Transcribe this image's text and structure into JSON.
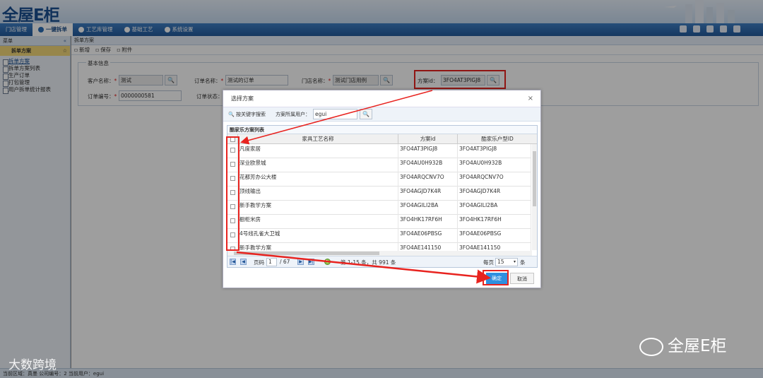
{
  "app": {
    "logo": "全屋E柜"
  },
  "nav": {
    "tabs": [
      {
        "label": "门店管理"
      },
      {
        "label": "一键拆单"
      },
      {
        "label": "工艺库管理"
      },
      {
        "label": "基础工艺"
      },
      {
        "label": "系统设置"
      }
    ]
  },
  "sidebar": {
    "title": "菜单",
    "collapse": "«",
    "group": "拆单方案",
    "group_toggle": "☆",
    "items": [
      {
        "label": "拆单方案"
      },
      {
        "label": "拆单方案列表"
      },
      {
        "label": "生产订单"
      },
      {
        "label": "打包管理"
      },
      {
        "label": "用户拆单统计报表"
      }
    ]
  },
  "main": {
    "breadcrumb": "拆单方案",
    "toolbar": {
      "new": "新增",
      "save": "保存",
      "attach": "附件"
    },
    "section": "基本信息",
    "fields": {
      "customer_label": "客户名称：",
      "customer_value": "测试",
      "order_name_label": "订单名称：",
      "order_name_value": "测试的订单",
      "store_label": "门店名称：",
      "store_value": "测试门店用例",
      "scheme_id_label": "方案id：",
      "scheme_id_value": "3FO4AT3PIGJ8",
      "order_no_label": "订单编号：",
      "order_no_value": "0000000581",
      "order_status_label": "订单状态："
    }
  },
  "dialog": {
    "title": "选择方案",
    "close": "×",
    "search_label": "按关键字搜索",
    "owner_label": "方案所属用户：",
    "owner_value": "egui",
    "grid_caption": "酷家乐方案列表",
    "columns": [
      "家具工艺名称",
      "方案id",
      "酷家乐户型ID"
    ],
    "rows": [
      {
        "name": "凡度家居",
        "scheme_id": "3FO4AT3PIGJ8",
        "layout_id": "3FO4AT3PIGJ8"
      },
      {
        "name": "深业欧景城",
        "scheme_id": "3FO4AU0H932B",
        "layout_id": "3FO4AU0H932B"
      },
      {
        "name": "花都芳办公大楼",
        "scheme_id": "3FO4ARQCNV7O",
        "layout_id": "3FO4ARQCNV7O"
      },
      {
        "name": "顶线输出",
        "scheme_id": "3FO4AGJD7K4R",
        "layout_id": "3FO4AGJD7K4R"
      },
      {
        "name": "新手教学方案",
        "scheme_id": "3FO4AGILI2BA",
        "layout_id": "3FO4AGILI2BA"
      },
      {
        "name": "橱柜米房",
        "scheme_id": "3FO4HK17RF6H",
        "layout_id": "3FO4HK17RF6H"
      },
      {
        "name": "4号线孔雀大卫城",
        "scheme_id": "3FO4AE06PBSG",
        "layout_id": "3FO4AE06PBSG"
      },
      {
        "name": "新手教学方案",
        "scheme_id": "3FO4AE141150",
        "layout_id": "3FO4AE141150"
      }
    ],
    "pager": {
      "page_label": "页码",
      "page": "1",
      "of": "/ 67",
      "record_info": "第 1-15 条，共 991 条",
      "per_page_label": "每页",
      "per_page": "15",
      "unit": "条"
    },
    "confirm": "确定",
    "cancel": "取消"
  },
  "status": {
    "text": "当前区域：真墨  公司编号：2  当前用户：egui"
  },
  "watermarks": {
    "left": "大数跨境",
    "right": "全屋E柜"
  }
}
